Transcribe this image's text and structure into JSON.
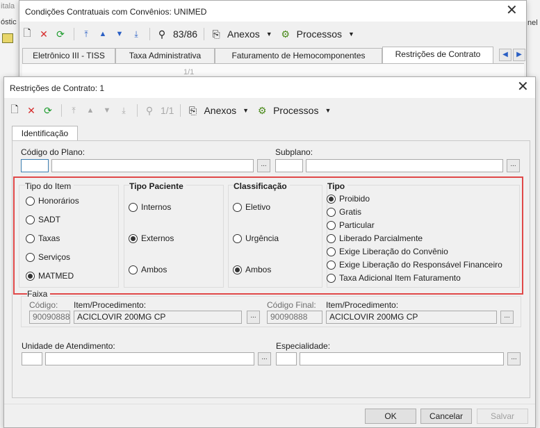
{
  "background": {
    "left_fragments": [
      "itala",
      "óstic"
    ],
    "right_fragment": "nel"
  },
  "outer_window": {
    "title": "Condições Contratuais com Convênios: UNIMED",
    "record_counter": "83/86",
    "anexos_label": "Anexos",
    "processos_label": "Processos",
    "tabs": [
      "Eletrônico III - TISS",
      "Taxa Administrativa",
      "Faturamento de Hemocomponentes",
      "Restrições de Contrato"
    ],
    "peek_counter": "1/1"
  },
  "dialog": {
    "title": "Restrições de Contrato: 1",
    "record_counter": "1/1",
    "anexos_label": "Anexos",
    "processos_label": "Processos",
    "tab": "Identificação",
    "codigo_plano_label": "Código do Plano:",
    "codigo_plano_value": "",
    "plano_desc_value": "",
    "subplano_label": "Subplano:",
    "subplano_value": "",
    "subplano_desc_value": "",
    "groups": {
      "tipo_item": {
        "title": "Tipo do Item",
        "options": [
          "Honorários",
          "SADT",
          "Taxas",
          "Serviços",
          "MATMED"
        ],
        "selected": "MATMED"
      },
      "tipo_paciente": {
        "title": "Tipo Paciente",
        "options": [
          "Internos",
          "Externos",
          "Ambos"
        ],
        "selected": "Externos"
      },
      "classificacao": {
        "title": "Classificação",
        "options": [
          "Eletivo",
          "Urgência",
          "Ambos"
        ],
        "selected": "Ambos"
      },
      "tipo": {
        "title": "Tipo",
        "options": [
          "Proibido",
          "Gratis",
          "Particular",
          "Liberado Parcialmente",
          "Exige Liberação do Convênio",
          "Exige Liberação do Responsável Financeiro",
          "Taxa Adicional Item Faturamento"
        ],
        "selected": "Proibido"
      }
    },
    "faixa": {
      "title": "Faixa",
      "codigo_label": "Código:",
      "codigo_value": "90090888",
      "item_label": "Item/Procedimento:",
      "item_value": "ACICLOVIR 200MG CP",
      "codigo_final_label": "Código Final:",
      "codigo_final_value": "90090888",
      "item_final_label": "Item/Procedimento:",
      "item_final_value": "ACICLOVIR 200MG CP"
    },
    "unidade_label": "Unidade de Atendimento:",
    "especialidade_label": "Especialidade:",
    "buttons": {
      "ok": "OK",
      "cancelar": "Cancelar",
      "salvar": "Salvar"
    }
  },
  "colors": {
    "highlight": "#e04848",
    "refresh_green": "#1a9a2a",
    "delete_red": "#d62b2b",
    "nav_blue": "#2a5fc4"
  }
}
